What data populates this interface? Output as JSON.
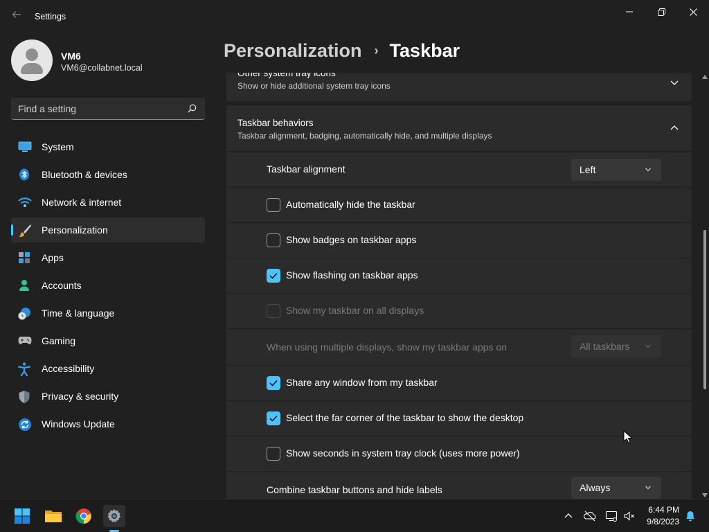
{
  "window": {
    "title": "Settings",
    "controls": {
      "minimize_icon": "minimize-icon",
      "restore_icon": "restore-icon",
      "close_icon": "close-icon"
    }
  },
  "profile": {
    "name": "VM6",
    "email": "VM6@collabnet.local"
  },
  "search": {
    "placeholder": "Find a setting"
  },
  "sidebar": {
    "items": [
      {
        "label": "System",
        "icon": "system-icon",
        "active": false
      },
      {
        "label": "Bluetooth & devices",
        "icon": "bluetooth-icon",
        "active": false
      },
      {
        "label": "Network & internet",
        "icon": "wifi-icon",
        "active": false
      },
      {
        "label": "Personalization",
        "icon": "brush-icon",
        "active": true
      },
      {
        "label": "Apps",
        "icon": "apps-icon",
        "active": false
      },
      {
        "label": "Accounts",
        "icon": "accounts-icon",
        "active": false
      },
      {
        "label": "Time & language",
        "icon": "clock-globe-icon",
        "active": false
      },
      {
        "label": "Gaming",
        "icon": "gamepad-icon",
        "active": false
      },
      {
        "label": "Accessibility",
        "icon": "accessibility-icon",
        "active": false
      },
      {
        "label": "Privacy & security",
        "icon": "shield-icon",
        "active": false
      },
      {
        "label": "Windows Update",
        "icon": "update-icon",
        "active": false
      }
    ]
  },
  "breadcrumb": {
    "parent": "Personalization",
    "separator": "›",
    "current": "Taskbar"
  },
  "sections": {
    "tray": {
      "title": "Other system tray icons",
      "subtitle": "Show or hide additional system tray icons",
      "expanded": false
    },
    "behaviors": {
      "title": "Taskbar behaviors",
      "subtitle": "Taskbar alignment, badging, automatically hide, and multiple displays",
      "expanded": true,
      "alignment": {
        "label": "Taskbar alignment",
        "value": "Left"
      },
      "auto_hide": {
        "label": "Automatically hide the taskbar",
        "checked": false
      },
      "badges": {
        "label": "Show badges on taskbar apps",
        "checked": false
      },
      "flashing": {
        "label": "Show flashing on taskbar apps",
        "checked": true
      },
      "all_displays": {
        "label": "Show my taskbar on all displays",
        "checked": false,
        "disabled": true
      },
      "multi_display": {
        "label": "When using multiple displays, show my taskbar apps on",
        "value": "All taskbars",
        "disabled": true
      },
      "share_window": {
        "label": "Share any window from my taskbar",
        "checked": true
      },
      "far_corner": {
        "label": "Select the far corner of the taskbar to show the desktop",
        "checked": true
      },
      "seconds": {
        "label": "Show seconds in system tray clock (uses more power)",
        "checked": false
      },
      "combine": {
        "label": "Combine taskbar buttons and hide labels",
        "value": "Always"
      }
    }
  },
  "taskbar": {
    "apps": [
      "windows-start-icon",
      "file-explorer-icon",
      "chrome-icon",
      "settings-icon"
    ],
    "tray": [
      "chevron-up-icon",
      "onedrive-offline-icon",
      "network-icon",
      "volume-muted-icon",
      "notification-bell-icon"
    ],
    "time": "6:44 PM",
    "date": "9/8/2023"
  },
  "colors": {
    "accent": "#4cc2ff",
    "background": "#202020",
    "card": "#2b2b2b"
  }
}
